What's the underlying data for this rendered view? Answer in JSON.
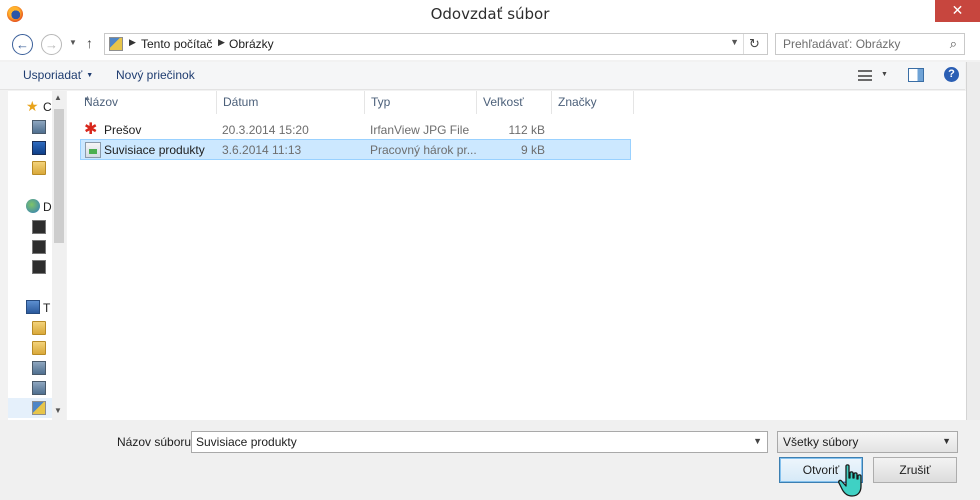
{
  "window": {
    "title": "Odovzdať súbor",
    "close_glyph": "✕"
  },
  "nav": {
    "breadcrumb": [
      "Tento počítač",
      "Obrázky"
    ],
    "search_placeholder": "Prehľadávať: Obrázky",
    "back_glyph": "←",
    "forward_glyph": "→",
    "up_glyph": "↑",
    "refresh_glyph": "↻"
  },
  "toolbar": {
    "organize": "Usporiadať",
    "new_folder": "Nový priečinok",
    "help_glyph": "?"
  },
  "navpane": {
    "items": [
      {
        "icon": "star-icon",
        "label": "C"
      },
      {
        "icon": "network-folder-icon",
        "label": ""
      },
      {
        "icon": "desktop-icon",
        "label": ""
      },
      {
        "icon": "folder-icon",
        "label": ""
      },
      {
        "icon": "globe-icon",
        "label": "D"
      },
      {
        "icon": "user-icon",
        "label": ""
      },
      {
        "icon": "user-icon",
        "label": ""
      },
      {
        "icon": "user-icon",
        "label": ""
      },
      {
        "icon": "computer-icon",
        "label": "T"
      },
      {
        "icon": "folder-icon",
        "label": ""
      },
      {
        "icon": "folder-icon",
        "label": ""
      },
      {
        "icon": "network-folder-icon",
        "label": ""
      },
      {
        "icon": "network-folder-icon",
        "label": ""
      },
      {
        "icon": "pictures-folder-icon",
        "label": ""
      }
    ]
  },
  "filelist": {
    "columns": [
      "Názov",
      "Dátum",
      "Typ",
      "Veľkosť",
      "Značky"
    ],
    "rows": [
      {
        "icon": "irfanview-icon",
        "name": "Prešov",
        "date": "20.3.2014 15:20",
        "type": "IrfanView JPG File",
        "size": "112 kB",
        "selected": false
      },
      {
        "icon": "spreadsheet-icon",
        "name": "Suvisiace produkty",
        "date": "3.6.2014 11:13",
        "type": "Pracovný hárok pr...",
        "size": "9 kB",
        "selected": true
      }
    ]
  },
  "footer": {
    "filename_label": "Názov súboru:",
    "filename_value": "Suvisiace produkty",
    "filetype_value": "Všetky súbory",
    "open_button": "Otvoriť",
    "cancel_button": "Zrušiť"
  },
  "colors": {
    "selection": "#cce8ff",
    "selection_border": "#99d1ff",
    "close_button": "#c7463e",
    "link_text": "#1e3c70"
  }
}
